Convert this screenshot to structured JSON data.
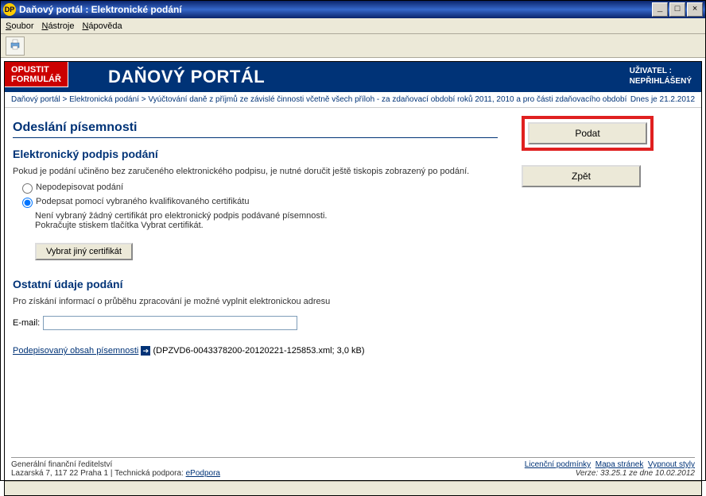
{
  "window": {
    "title": "Daňový portál : Elektronické podání",
    "icon_text": "DP"
  },
  "menu": {
    "soubor": "Soubor",
    "nastroje": "Nástroje",
    "napoveda": "Nápověda"
  },
  "header": {
    "exit_line1": "OPUSTIT",
    "exit_line2": "FORMULÁŘ",
    "portal_title": "DAŇOVÝ PORTÁL",
    "user_label": "UŽIVATEL :",
    "user_status": "NEPŘIHLÁŠENÝ"
  },
  "breadcrumb": {
    "items": [
      "Daňový portál",
      "Elektronická podání",
      "Vyúčtování daně z příjmů ze závislé činnosti včetně všech příloh - za zdaňovací období roků 2011, 2010 a pro části zdaňovacího období"
    ],
    "separator": " > ",
    "date_text": "Dnes je 21.2.2012"
  },
  "main": {
    "title": "Odeslání písemnosti",
    "sig_title": "Elektronický podpis podání",
    "sig_body": "Pokud je podání učiněno bez zaručeného elektronického podpisu, je nutné doručit ještě tiskopis zobrazený po podání.",
    "radio_unsigned": "Nepodepisovat podání",
    "radio_signed": "Podepsat pomocí vybraného kvalifikovaného certifikátu",
    "note_line1": "Není vybraný žádný certifikát pro elektronický podpis podávané písemnosti.",
    "note_line2": "Pokračujte stiskem tlačítka Vybrat certifikát.",
    "cert_btn": "Vybrat jiný certifikát",
    "other_title": "Ostatní údaje podání",
    "other_body": "Pro získání informací o průběhu zpracování je možné vyplnit elektronickou adresu",
    "email_label": "E-mail:",
    "email_value": "",
    "signed_content_link": "Podepisovaný obsah písemnosti",
    "signed_content_meta": "(DPZVD6-0043378200-20120221-125853.xml; 3,0 kB)"
  },
  "actions": {
    "submit": "Podat",
    "back": "Zpět"
  },
  "footer": {
    "org_line1": "Generální finanční ředitelství",
    "org_line2": "Lazarská 7, 117 22 Praha 1 | Technická podpora: ",
    "support_link": "ePodpora",
    "links": {
      "licence": "Licenční podmínky",
      "sitemap": "Mapa stránek",
      "nostyle": "Vypnout styly"
    },
    "version": "Verze: 33.25.1 ze dne 10.02.2012"
  }
}
